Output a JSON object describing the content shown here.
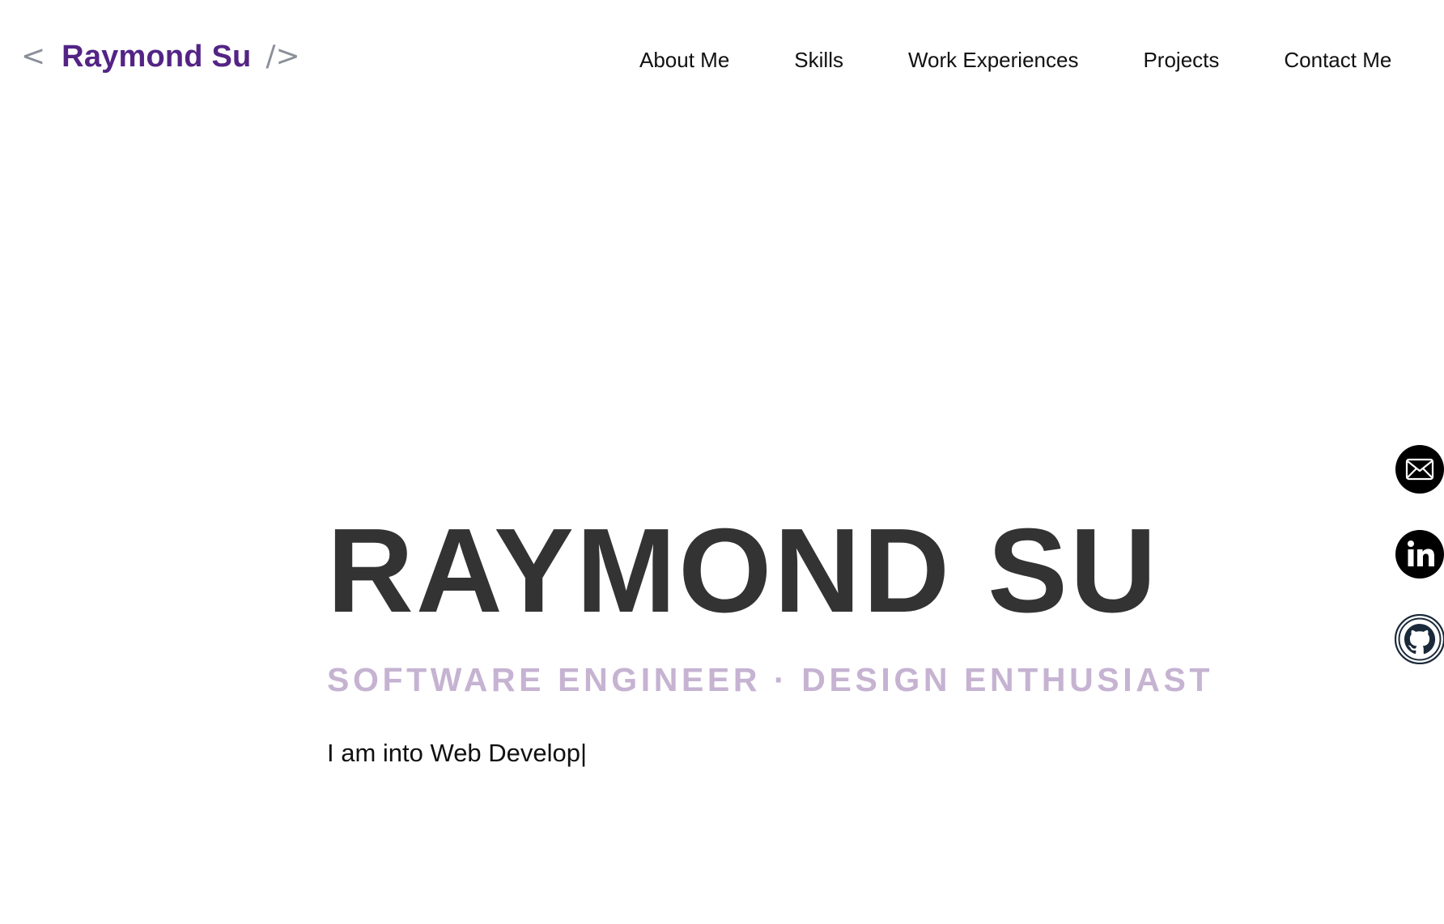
{
  "brand": {
    "open_bracket": "<",
    "name": "Raymond Su",
    "close_bracket": "/>"
  },
  "nav": {
    "items": [
      {
        "label": "About Me"
      },
      {
        "label": "Skills"
      },
      {
        "label": "Work Experiences"
      },
      {
        "label": "Projects"
      },
      {
        "label": "Contact Me"
      }
    ]
  },
  "hero": {
    "title": "RAYMOND SU",
    "subtitle": "SOFTWARE ENGINEER · DESIGN ENTHUSIAST",
    "typewriter_text": "I am into Web Develop",
    "cursor": "|"
  },
  "social": [
    {
      "icon": "mail-icon"
    },
    {
      "icon": "linkedin-icon"
    },
    {
      "icon": "github-icon"
    }
  ],
  "colors": {
    "brand_purple": "#532485",
    "bracket_gray": "#8a8f99",
    "title_dark": "#333333",
    "subtitle_lavender": "#c6b3d2",
    "icon_black": "#000000",
    "github_dark": "#1b2a3a"
  }
}
